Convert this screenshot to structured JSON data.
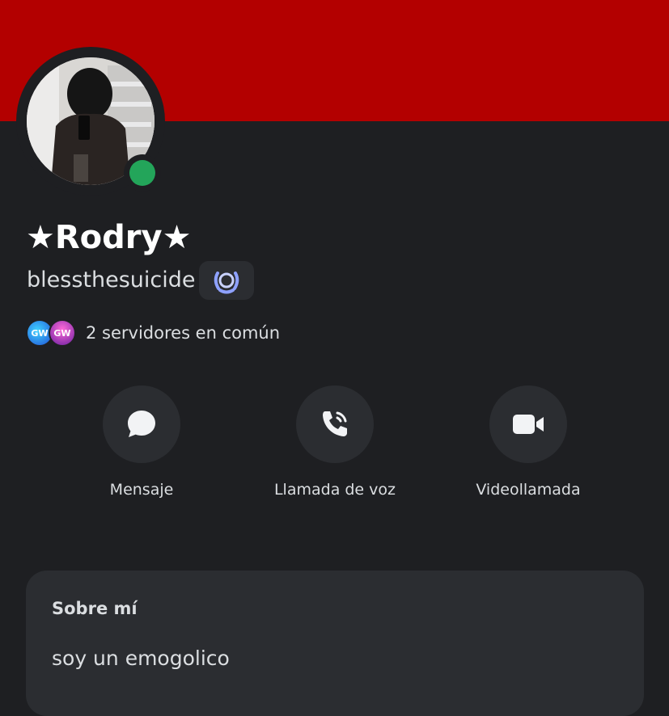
{
  "banner": {
    "color": "#b30000"
  },
  "profile": {
    "display_name": "★Rodry★",
    "username": "blessthesuicide",
    "status": "online",
    "status_color": "#23a55a",
    "badge_icon": "laurel-badge-icon"
  },
  "mutual": {
    "guild_1_label": "GW",
    "guild_2_label": "GW",
    "text": "2 servidores en común"
  },
  "actions": {
    "message_label": "Mensaje",
    "voice_label": "Llamada de voz",
    "video_label": "Videollamada"
  },
  "about": {
    "title": "Sobre mí",
    "text": "soy un emogolico"
  },
  "colors": {
    "background": "#1e1f22",
    "card": "#2b2d31",
    "text": "#dbdee1",
    "badge_accent": "#8ea1ff"
  }
}
